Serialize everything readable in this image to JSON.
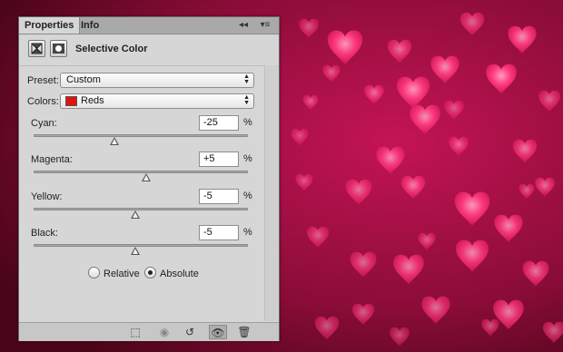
{
  "panel": {
    "tabs": [
      {
        "label": "Properties",
        "active": true
      },
      {
        "label": "Info",
        "active": false
      }
    ],
    "collapse_icon": "double-chevron-left-icon",
    "menu_icon": "panel-menu-icon",
    "title": "Selective Color"
  },
  "preset": {
    "label": "Preset:",
    "value": "Custom"
  },
  "colors": {
    "label": "Colors:",
    "value": "Reds",
    "swatch_color": "#e0140e"
  },
  "adjustments": [
    {
      "label": "Cyan:",
      "value": "-25",
      "unit": "%",
      "slider_fraction": 0.375
    },
    {
      "label": "Magenta:",
      "value": "+5",
      "unit": "%",
      "slider_fraction": 0.525
    },
    {
      "label": "Yellow:",
      "value": "-5",
      "unit": "%",
      "slider_fraction": 0.475
    },
    {
      "label": "Black:",
      "value": "-5",
      "unit": "%",
      "slider_fraction": 0.475
    }
  ],
  "method": {
    "options": [
      "Relative",
      "Absolute"
    ],
    "selected": "Absolute"
  },
  "footer_icons": [
    "clip-to-layer-icon",
    "view-previous-state-icon",
    "reset-icon",
    "visibility-eye-icon",
    "trash-icon"
  ],
  "colors_theme": {
    "background": "#6a0a2a",
    "hearts": "#ff3c82"
  }
}
